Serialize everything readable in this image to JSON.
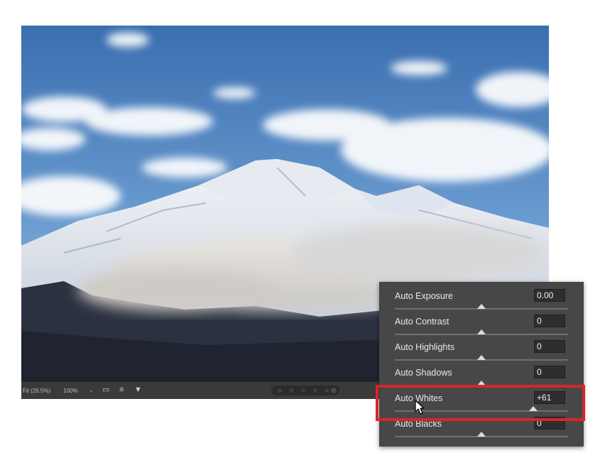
{
  "photo": {
    "description_icon": "mountain-photo"
  },
  "bottom_bar": {
    "zoom_fit": "Fit (26.5%)",
    "zoom_actual": "100%",
    "rating_stars": "☆ ☆ ☆ ☆ ☆"
  },
  "panel": {
    "rows": [
      {
        "label": "Auto Exposure",
        "value": "0.00",
        "slider_fraction": 0.5
      },
      {
        "label": "Auto Contrast",
        "value": "0",
        "slider_fraction": 0.5
      },
      {
        "label": "Auto Highlights",
        "value": "0",
        "slider_fraction": 0.5
      },
      {
        "label": "Auto Shadows",
        "value": "0",
        "slider_fraction": 0.5
      },
      {
        "label": "Auto Whites",
        "value": "+61",
        "slider_fraction": 0.8
      },
      {
        "label": "Auto Blacks",
        "value": "0",
        "slider_fraction": 0.5
      }
    ]
  },
  "colors": {
    "highlight": "#d7262b",
    "panel_bg": "#474747"
  }
}
